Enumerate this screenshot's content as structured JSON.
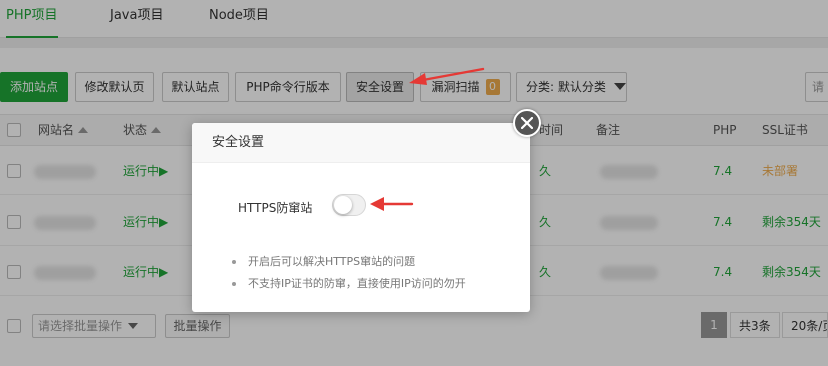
{
  "tabs": [
    {
      "label": "PHP项目",
      "active": true
    },
    {
      "label": "Java项目",
      "active": false
    },
    {
      "label": "Node项目",
      "active": false
    }
  ],
  "toolbar": {
    "add_site": "添加站点",
    "edit_default_page": "修改默认页",
    "default_site": "默认站点",
    "php_cli_version": "PHP命令行版本",
    "security_settings": "安全设置",
    "vuln_scan": "漏洞扫描",
    "vuln_scan_count": "0",
    "category_select": "分类: 默认分类",
    "search_placeholder": "请"
  },
  "table": {
    "headers": {
      "site_name": "网站名",
      "status": "状态",
      "expire_partial": "时间",
      "remark": "备注",
      "php": "PHP",
      "ssl": "SSL证书"
    },
    "rows": [
      {
        "status": "运行中",
        "expire_partial": "久",
        "php": "7.4",
        "ssl": "未部署",
        "ssl_state": "warn"
      },
      {
        "status": "运行中",
        "expire_partial": "久",
        "php": "7.4",
        "ssl": "剩余354天",
        "ssl_state": "ok"
      },
      {
        "status": "运行中",
        "expire_partial": "久",
        "php": "7.4",
        "ssl": "剩余354天",
        "ssl_state": "ok"
      }
    ]
  },
  "footer": {
    "batch_select_placeholder": "请选择批量操作",
    "batch_action": "批量操作",
    "page": "1",
    "total": "共3条",
    "page_size": "20条/页"
  },
  "modal": {
    "title": "安全设置",
    "option_label": "HTTPS防窜站",
    "toggle_on": false,
    "tips": [
      "开启后可以解决HTTPS窜站的问题",
      "不支持IP证书的防窜，直接使用IP访问的勿开"
    ]
  },
  "colors": {
    "brand_green": "#20a53a",
    "warn_orange": "#f0ad4e",
    "annotation_red": "#e53935"
  }
}
